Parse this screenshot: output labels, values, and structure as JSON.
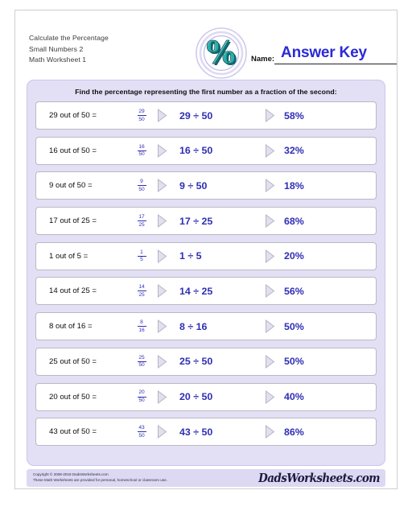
{
  "header": {
    "title_lines": [
      "Calculate the Percentage",
      "Small Numbers 2",
      "Math Worksheet 1"
    ],
    "logo_symbol": "%",
    "name_label": "Name:",
    "name_value": "Answer Key"
  },
  "instruction": "Find the percentage representing the first number as a fraction of the second:",
  "problems": [
    {
      "prompt": "29 out of 50 =",
      "numerator": "29",
      "denominator": "50",
      "expression": "29 ÷ 50",
      "answer": "58%"
    },
    {
      "prompt": "16 out of 50 =",
      "numerator": "16",
      "denominator": "50",
      "expression": "16 ÷ 50",
      "answer": "32%"
    },
    {
      "prompt": "9 out of 50 =",
      "numerator": "9",
      "denominator": "50",
      "expression": "9 ÷ 50",
      "answer": "18%"
    },
    {
      "prompt": "17 out of 25 =",
      "numerator": "17",
      "denominator": "25",
      "expression": "17 ÷ 25",
      "answer": "68%"
    },
    {
      "prompt": "1 out of 5 =",
      "numerator": "1",
      "denominator": "5",
      "expression": "1 ÷ 5",
      "answer": "20%"
    },
    {
      "prompt": "14 out of 25 =",
      "numerator": "14",
      "denominator": "25",
      "expression": "14 ÷ 25",
      "answer": "56%"
    },
    {
      "prompt": "8 out of 16 =",
      "numerator": "8",
      "denominator": "16",
      "expression": "8 ÷ 16",
      "answer": "50%"
    },
    {
      "prompt": "25 out of 50 =",
      "numerator": "25",
      "denominator": "50",
      "expression": "25 ÷ 50",
      "answer": "50%"
    },
    {
      "prompt": "20 out of 50 =",
      "numerator": "20",
      "denominator": "50",
      "expression": "20 ÷ 50",
      "answer": "40%"
    },
    {
      "prompt": "43 out of 50 =",
      "numerator": "43",
      "denominator": "50",
      "expression": "43 ÷ 50",
      "answer": "86%"
    }
  ],
  "footer": {
    "copyright_line1": "Copyright © 2008-2019 DadsWorksheets.com",
    "copyright_line2": "These Math Worksheets are provided for personal, homeschool or classroom use.",
    "brand": "DadsWorksheets.com"
  },
  "colors": {
    "accent_blue": "#2f2fb5",
    "answer_key_blue": "#2a2ad6",
    "panel_lavender": "#e3e0f5",
    "logo_teal": "#1f9e9e"
  }
}
